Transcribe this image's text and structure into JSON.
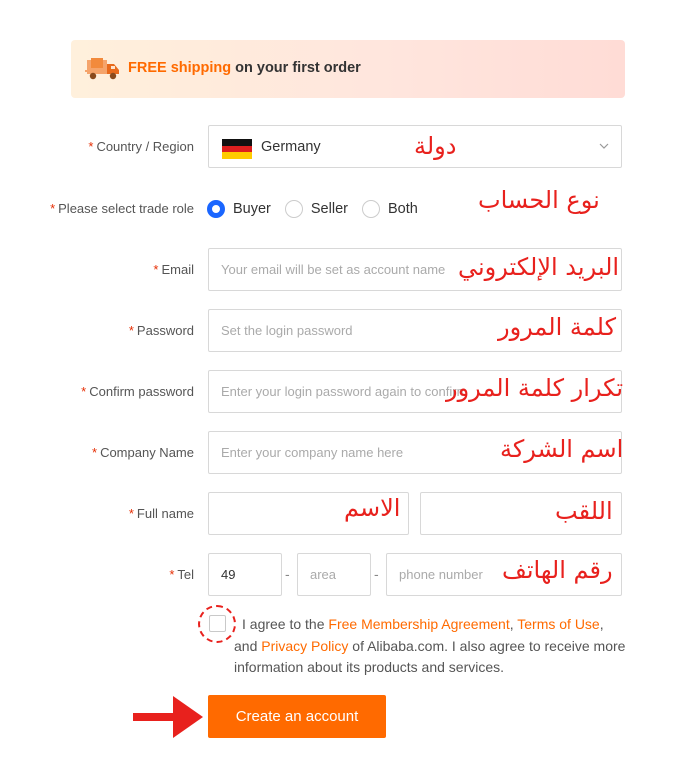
{
  "banner": {
    "highlight": "FREE shipping",
    "rest": "on your first order",
    "icon": "truck-icon"
  },
  "form": {
    "country": {
      "label": "Country / Region",
      "value": "Germany",
      "flag_icon": "germany-flag-icon"
    },
    "trade_role": {
      "label": "Please select trade role",
      "options": [
        "Buyer",
        "Seller",
        "Both"
      ],
      "selected": "Buyer"
    },
    "email": {
      "label": "Email",
      "placeholder": "Your email will be set as account name"
    },
    "password": {
      "label": "Password",
      "placeholder": "Set the login password"
    },
    "confirm_password": {
      "label": "Confirm password",
      "placeholder": "Enter your login password again to confirm"
    },
    "company": {
      "label": "Company Name",
      "placeholder": "Enter your company name here"
    },
    "full_name": {
      "label": "Full name",
      "first_placeholder": "",
      "last_placeholder": ""
    },
    "tel": {
      "label": "Tel",
      "code": "49",
      "area_placeholder": "area",
      "phone_placeholder": "phone number",
      "separator": "-"
    },
    "required_mark": "*"
  },
  "agreement": {
    "text1": "I agree to the ",
    "link1": "Free Membership Agreement",
    "text2": ", ",
    "link2": "Terms of Use",
    "text3": ", and ",
    "link3": "Privacy Policy",
    "text4": " of Alibaba.com. I also agree to receive more information about its products and services."
  },
  "submit_label": "Create an account",
  "annotations": {
    "country": "دولة",
    "trade_role": "نوع الحساب",
    "email": "البريد الإلكتروني",
    "password": "كلمة المرور",
    "confirm_password": "تكرار كلمة المرور",
    "company": "اسم الشركة",
    "first_name": "الاسم",
    "last_name": "اللقب",
    "tel": "رقم الهاتف",
    "color": "#e8211d"
  },
  "colors": {
    "accent": "#ff6a00",
    "radio_selected": "#1a66ff",
    "required": "#e62e04"
  }
}
